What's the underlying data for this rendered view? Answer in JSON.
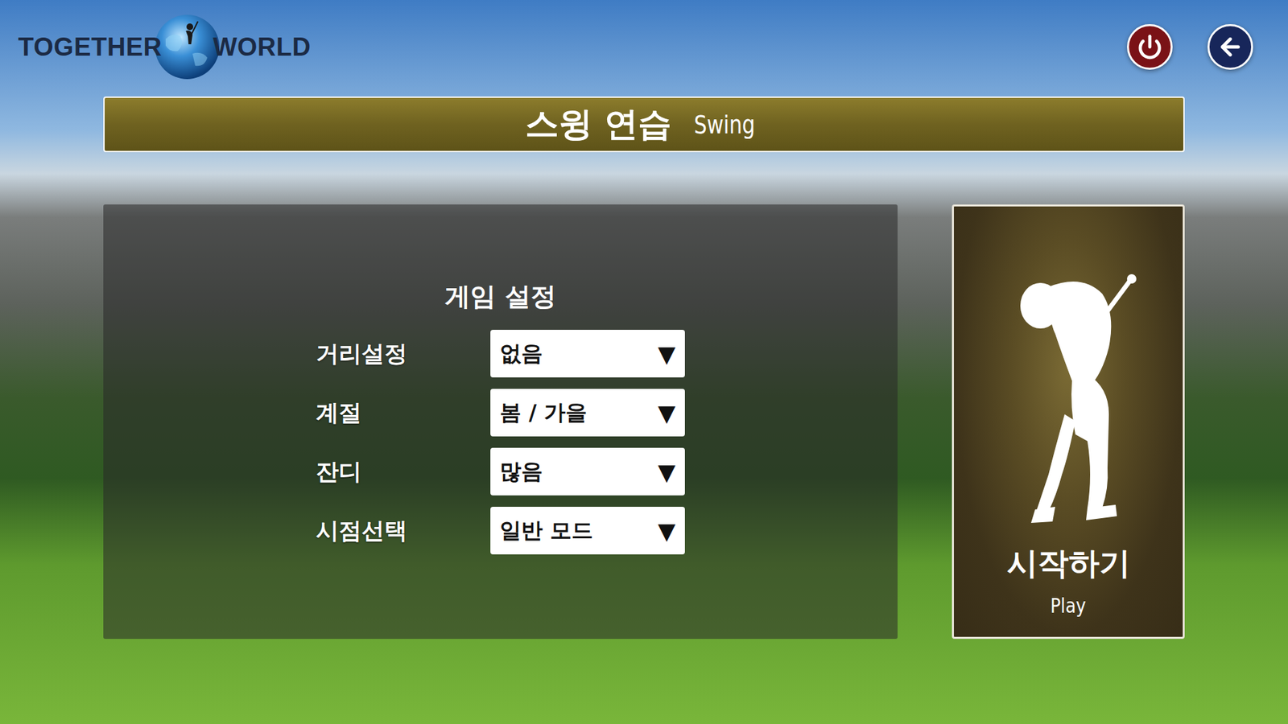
{
  "logo": {
    "words": [
      "TOGETHER",
      "WORLD"
    ]
  },
  "title": {
    "korean": "스윙 연습",
    "english": "Swing"
  },
  "settings": {
    "heading": "게임 설정",
    "rows": [
      {
        "label": "거리설정",
        "value": "없음",
        "arrow": "▼"
      },
      {
        "label": "계절",
        "value": "봄 / 가을",
        "arrow": "▼"
      },
      {
        "label": "잔디",
        "value": "많음",
        "arrow": "▼"
      },
      {
        "label": "시점선택",
        "value": "일반 모드",
        "arrow": "▼"
      }
    ]
  },
  "play": {
    "label": "시작하기",
    "sublabel": "Play"
  }
}
